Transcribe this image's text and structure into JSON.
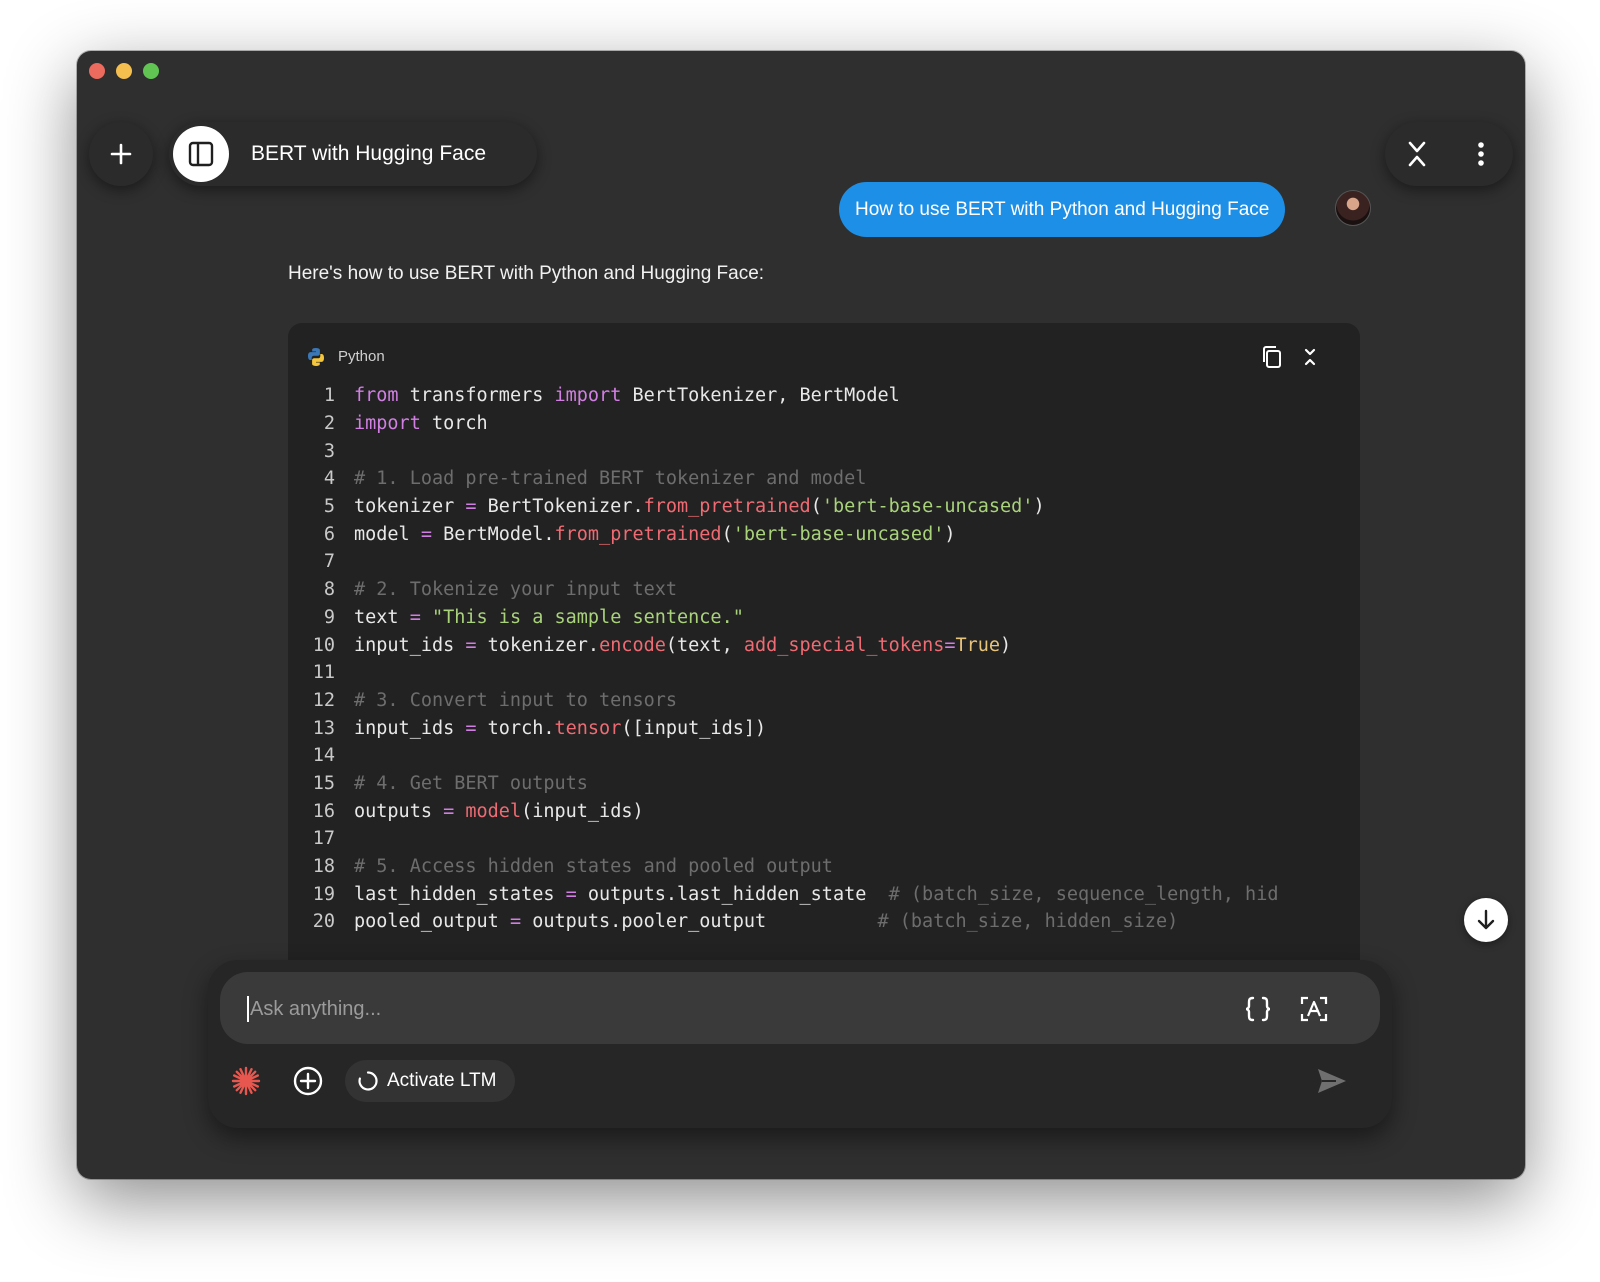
{
  "window": {
    "traffic_lights": [
      "close",
      "minimize",
      "maximize"
    ]
  },
  "header": {
    "new_chat_icon": "plus-icon",
    "sidebar_icon": "sidebar-panel-icon",
    "chat_title": "BERT with Hugging Face",
    "collapse_icon": "collapse-arrows-icon",
    "menu_icon": "vertical-dots-icon"
  },
  "conversation": {
    "user_message": "How to use BERT with Python and Hugging Face",
    "assistant_intro": "Here's how to use BERT with Python and Hugging Face:"
  },
  "code_block": {
    "language": "Python",
    "language_icon": "python-logo-icon",
    "copy_icon": "copy-icon",
    "collapse_icon": "collapse-icon",
    "lines": [
      {
        "n": "1",
        "tokens": [
          {
            "t": "from",
            "k": "kw"
          },
          {
            "t": " transformers ",
            "k": "plain"
          },
          {
            "t": "import",
            "k": "kw"
          },
          {
            "t": " BertTokenizer, BertModel",
            "k": "plain"
          }
        ]
      },
      {
        "n": "2",
        "tokens": [
          {
            "t": "import",
            "k": "kw"
          },
          {
            "t": " torch",
            "k": "plain"
          }
        ]
      },
      {
        "n": "3",
        "tokens": []
      },
      {
        "n": "4",
        "tokens": [
          {
            "t": "# 1. Load pre-trained BERT tokenizer and model",
            "k": "comment"
          }
        ]
      },
      {
        "n": "5",
        "tokens": [
          {
            "t": "tokenizer ",
            "k": "plain"
          },
          {
            "t": "=",
            "k": "op"
          },
          {
            "t": " BertTokenizer.",
            "k": "plain"
          },
          {
            "t": "from_pretrained",
            "k": "fn"
          },
          {
            "t": "(",
            "k": "plain"
          },
          {
            "t": "'bert-base-uncased'",
            "k": "str"
          },
          {
            "t": ")",
            "k": "plain"
          }
        ]
      },
      {
        "n": "6",
        "tokens": [
          {
            "t": "model ",
            "k": "plain"
          },
          {
            "t": "=",
            "k": "op"
          },
          {
            "t": " BertModel.",
            "k": "plain"
          },
          {
            "t": "from_pretrained",
            "k": "fn"
          },
          {
            "t": "(",
            "k": "plain"
          },
          {
            "t": "'bert-base-uncased'",
            "k": "str"
          },
          {
            "t": ")",
            "k": "plain"
          }
        ]
      },
      {
        "n": "7",
        "tokens": []
      },
      {
        "n": "8",
        "tokens": [
          {
            "t": "# 2. Tokenize your input text",
            "k": "comment"
          }
        ]
      },
      {
        "n": "9",
        "tokens": [
          {
            "t": "text ",
            "k": "plain"
          },
          {
            "t": "=",
            "k": "op"
          },
          {
            "t": " ",
            "k": "plain"
          },
          {
            "t": "\"This is a sample sentence.\"",
            "k": "str"
          }
        ]
      },
      {
        "n": "10",
        "tokens": [
          {
            "t": "input_ids ",
            "k": "plain"
          },
          {
            "t": "=",
            "k": "op"
          },
          {
            "t": " tokenizer.",
            "k": "plain"
          },
          {
            "t": "encode",
            "k": "fn"
          },
          {
            "t": "(text, ",
            "k": "plain"
          },
          {
            "t": "add_special_tokens",
            "k": "param"
          },
          {
            "t": "=",
            "k": "op"
          },
          {
            "t": "True",
            "k": "const"
          },
          {
            "t": ")",
            "k": "plain"
          }
        ]
      },
      {
        "n": "11",
        "tokens": []
      },
      {
        "n": "12",
        "tokens": [
          {
            "t": "# 3. Convert input to tensors",
            "k": "comment"
          }
        ]
      },
      {
        "n": "13",
        "tokens": [
          {
            "t": "input_ids ",
            "k": "plain"
          },
          {
            "t": "=",
            "k": "op"
          },
          {
            "t": " torch.",
            "k": "plain"
          },
          {
            "t": "tensor",
            "k": "fn"
          },
          {
            "t": "([input_ids])",
            "k": "plain"
          }
        ]
      },
      {
        "n": "14",
        "tokens": []
      },
      {
        "n": "15",
        "tokens": [
          {
            "t": "# 4. Get BERT outputs",
            "k": "comment"
          }
        ]
      },
      {
        "n": "16",
        "tokens": [
          {
            "t": "outputs ",
            "k": "plain"
          },
          {
            "t": "=",
            "k": "op"
          },
          {
            "t": " ",
            "k": "plain"
          },
          {
            "t": "model",
            "k": "fn"
          },
          {
            "t": "(input_ids)",
            "k": "plain"
          }
        ]
      },
      {
        "n": "17",
        "tokens": []
      },
      {
        "n": "18",
        "tokens": [
          {
            "t": "# 5. Access hidden states and pooled output",
            "k": "comment"
          }
        ]
      },
      {
        "n": "19",
        "tokens": [
          {
            "t": "last_hidden_states ",
            "k": "plain"
          },
          {
            "t": "=",
            "k": "op"
          },
          {
            "t": " outputs.last_hidden_state  ",
            "k": "plain"
          },
          {
            "t": "# (batch_size, sequence_length, hid",
            "k": "comment"
          }
        ]
      },
      {
        "n": "20",
        "tokens": [
          {
            "t": "pooled_output ",
            "k": "plain"
          },
          {
            "t": "=",
            "k": "op"
          },
          {
            "t": " outputs.pooler_output          ",
            "k": "plain"
          },
          {
            "t": "# (batch_size, hidden_size)",
            "k": "comment"
          }
        ]
      }
    ]
  },
  "scroll_down_icon": "arrow-down-icon",
  "composer": {
    "placeholder": "Ask anything...",
    "value": "",
    "braces_icon": "curly-braces-icon",
    "translate_icon": "text-scan-icon",
    "spark_icon": "spark-icon",
    "attach_icon": "plus-circle-icon",
    "ltm_label": "Activate LTM",
    "ltm_icon": "refresh-circle-icon",
    "send_icon": "send-icon"
  },
  "colors": {
    "accent": "#1e8fe6",
    "window_bg": "#2f2f2f",
    "code_bg": "#222222",
    "keyword": "#d17fe3",
    "string": "#a9d37b",
    "function": "#ef6b73",
    "comment": "#6d6d6d",
    "spark": "#e8574f"
  }
}
